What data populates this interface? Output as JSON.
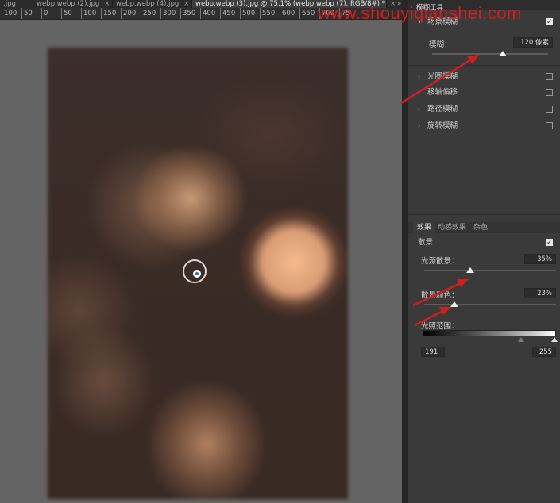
{
  "tabs": [
    {
      "label": ".jpg"
    },
    {
      "label": "webp.webp (2).jpg"
    },
    {
      "label": "webp.webp (4).jpg"
    },
    {
      "label": "webp.webp (3).jpg @ 75.1% (webp.webp (7), RGB/8#) *"
    }
  ],
  "collapse_label": "»",
  "ruler_ticks": [
    "100",
    "50",
    "0",
    "50",
    "100",
    "150",
    "200",
    "250",
    "300",
    "350",
    "400",
    "450",
    "500",
    "550",
    "600",
    "650",
    "700",
    "75"
  ],
  "watermark": "www.shouyiqianshei.com",
  "panel": {
    "title": "模糊工具",
    "field_blur": {
      "label": "场景模糊",
      "checked": true
    },
    "blur_amount": {
      "label": "模糊：",
      "value": "120 像素",
      "level_pct": 61
    },
    "other_blurs": [
      {
        "label": "光圈模糊",
        "checked": false
      },
      {
        "label": "移轴偏移",
        "checked": false
      },
      {
        "label": "路径模糊",
        "checked": false
      },
      {
        "label": "旋转模糊",
        "checked": false
      }
    ]
  },
  "effects": {
    "tabs": [
      "效果",
      "动感效果",
      "杂色"
    ],
    "bokeh": {
      "label": "散景",
      "checked": true
    },
    "light_bokeh": {
      "label": "光源散景：",
      "value": "35%",
      "level_pct": 35
    },
    "bokeh_color": {
      "label": "散景颜色：",
      "value": "23%",
      "level_pct": 23
    },
    "light_range": {
      "label": "光照范围：",
      "low": "191",
      "high": "255"
    }
  },
  "colors": {
    "accent_red": "#d21e1e",
    "panel_bg": "#3a3a3a",
    "canvas_bg": "#646464"
  }
}
